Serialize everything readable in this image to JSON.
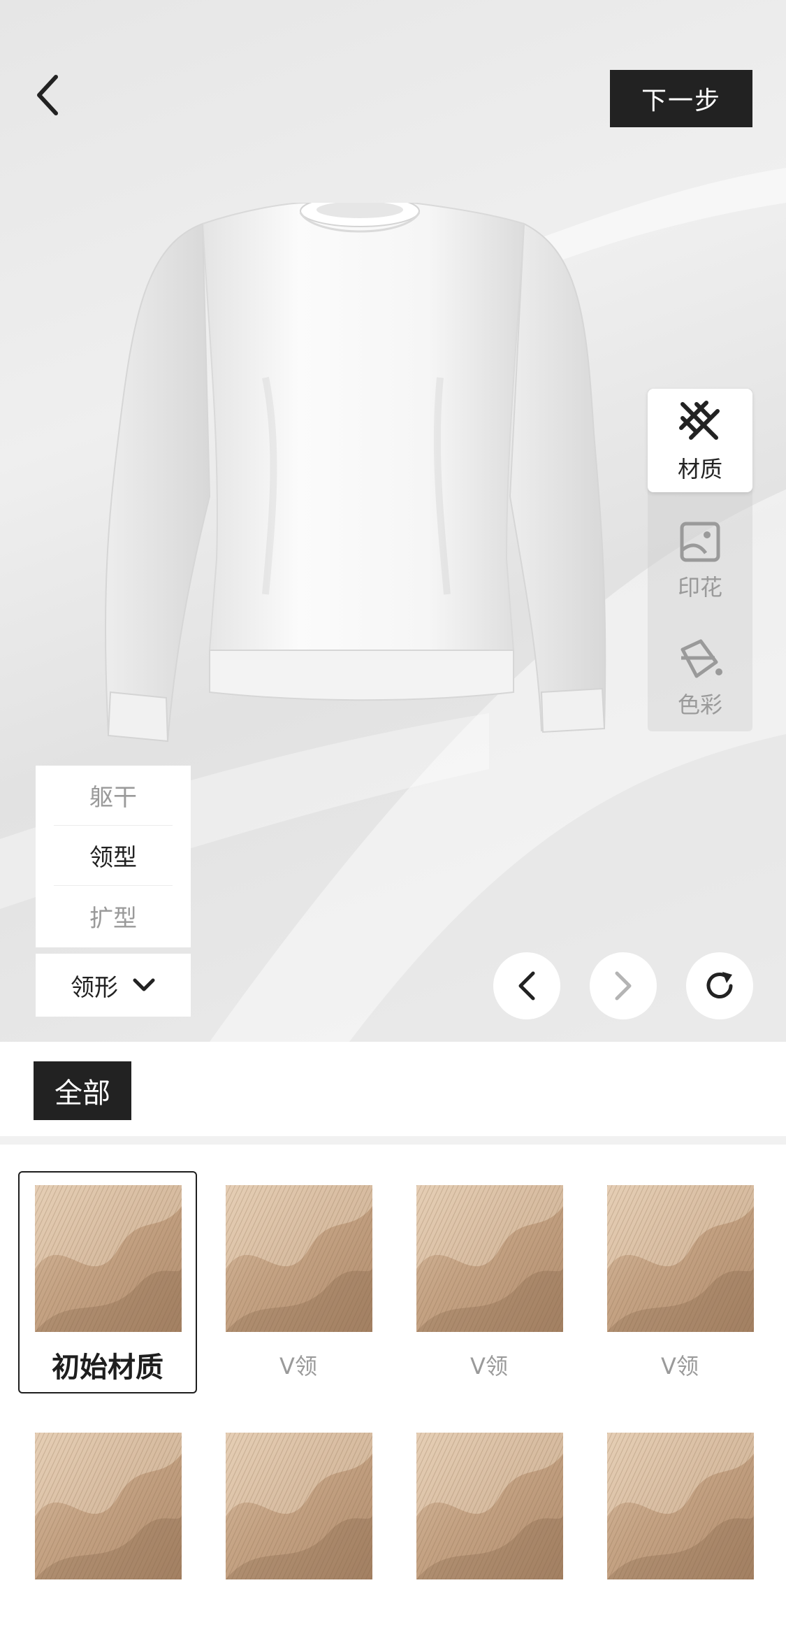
{
  "header": {
    "back_icon": "chevron-left-icon",
    "next_label": "下一步"
  },
  "tools": [
    {
      "label": "材质",
      "icon": "texture-icon",
      "active": true
    },
    {
      "label": "印花",
      "icon": "print-icon",
      "active": false
    },
    {
      "label": "色彩",
      "icon": "paint-bucket-icon",
      "active": false
    }
  ],
  "parts": {
    "items": [
      {
        "label": "躯干",
        "active": false
      },
      {
        "label": "领型",
        "active": true
      },
      {
        "label": "扩型",
        "active": false
      }
    ],
    "dropdown_label": "领形"
  },
  "controls": {
    "undo_icon": "chevron-left-icon",
    "redo_icon": "chevron-right-icon",
    "reset_icon": "refresh-icon"
  },
  "filter": {
    "active_label": "全部"
  },
  "materials": [
    {
      "label": "初始材质",
      "selected": true
    },
    {
      "label": "V领",
      "selected": false
    },
    {
      "label": "V领",
      "selected": false
    },
    {
      "label": "V领",
      "selected": false
    },
    {
      "label": "",
      "selected": false
    },
    {
      "label": "",
      "selected": false
    },
    {
      "label": "",
      "selected": false
    },
    {
      "label": "",
      "selected": false
    }
  ],
  "colors": {
    "dark": "#222222",
    "muted": "#9a9a9a",
    "fabric": "#c9a98a"
  }
}
